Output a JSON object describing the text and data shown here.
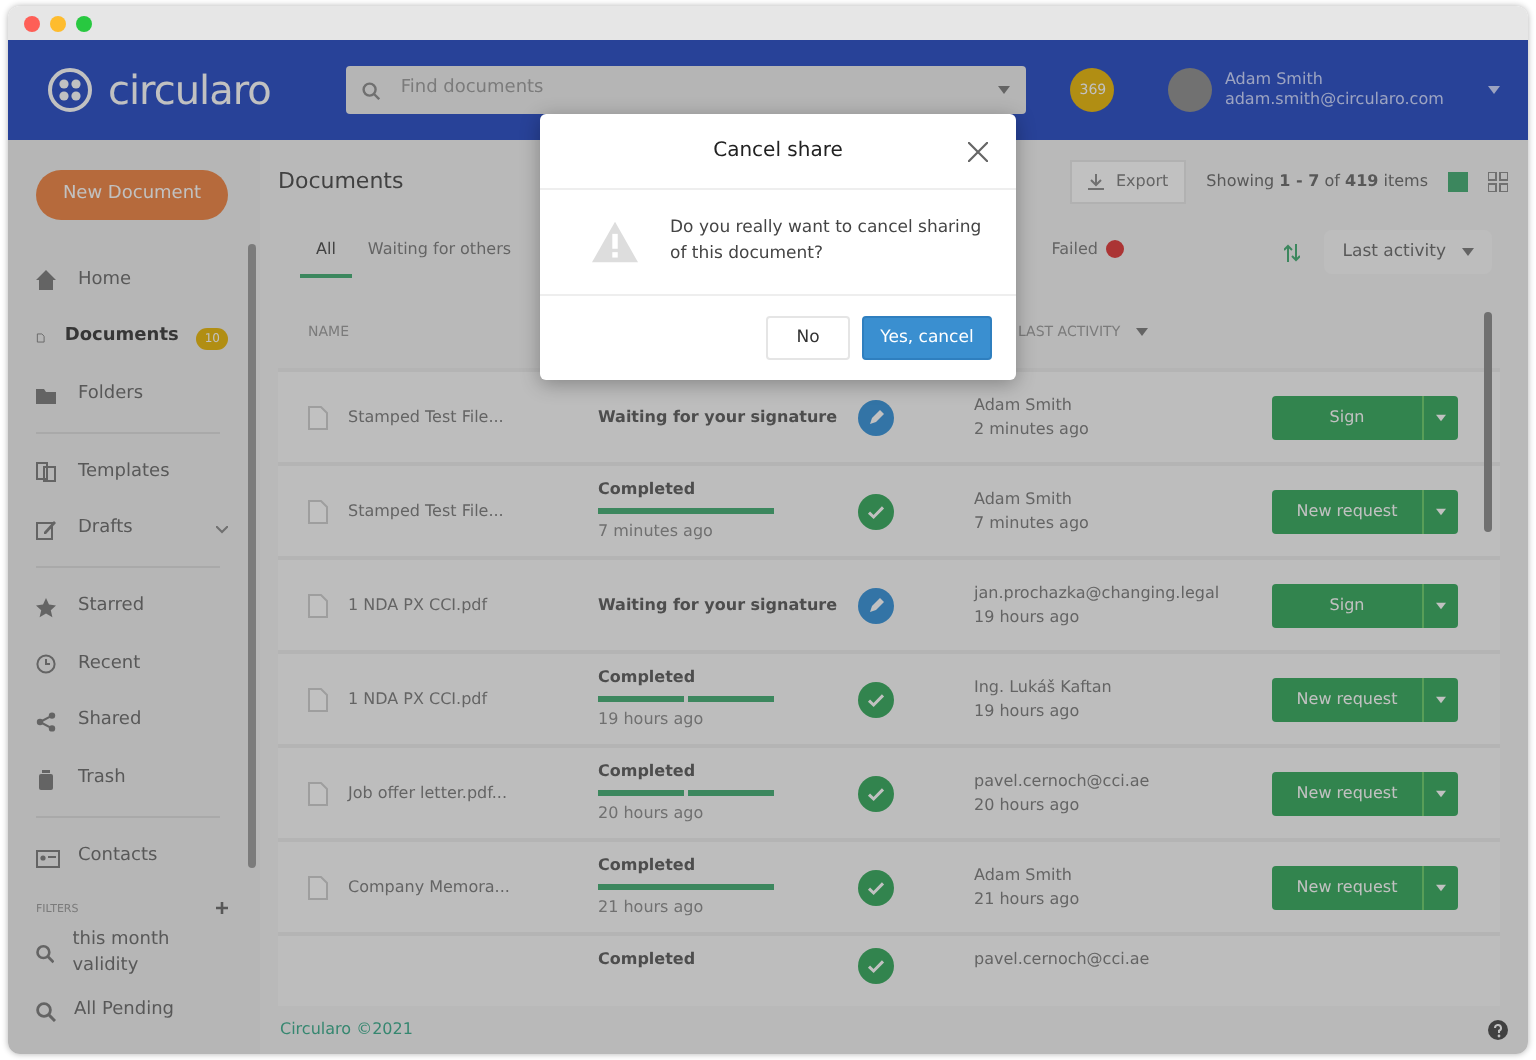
{
  "header": {
    "logo": "circularo",
    "search": {
      "placeholder": "Find documents"
    },
    "credits": "369",
    "user": {
      "name": "Adam Smith",
      "email": "adam.smith@circularo.com"
    }
  },
  "sidebar": {
    "new_button": "New Document",
    "items": [
      {
        "label": "Home",
        "selected": false
      },
      {
        "label": "Documents",
        "selected": true,
        "badge": "10"
      },
      {
        "label": "Folders",
        "selected": false
      },
      {
        "label": "Templates",
        "selected": false
      },
      {
        "label": "Drafts",
        "selected": false,
        "expandable": true
      },
      {
        "label": "Starred",
        "selected": false
      },
      {
        "label": "Recent",
        "selected": false
      },
      {
        "label": "Shared",
        "selected": false
      },
      {
        "label": "Trash",
        "selected": false
      },
      {
        "label": "Contacts",
        "selected": false
      }
    ],
    "filters_label": "FILTERS",
    "filters": [
      "this month validity",
      "All Pending"
    ]
  },
  "main": {
    "title": "Documents",
    "export": "Export",
    "showing": "Showing **1 - 7** of **419** items",
    "views": [
      {
        "kind": "list",
        "selected": true
      },
      {
        "kind": "grid",
        "selected": false
      }
    ],
    "tabs": [
      {
        "label": "All",
        "selected": true
      },
      {
        "label": "Waiting for others",
        "selected": false
      },
      {
        "label": "Failed",
        "selected": false,
        "badge": true
      }
    ],
    "sort": "Last activity",
    "columns": [
      "NAME",
      "LAST ACTIVITY"
    ],
    "rows": [
      {
        "name": "Stamped Test File...",
        "kind": "waiting",
        "status_text": "Waiting for your signature",
        "actor": "Adam Smith",
        "actor_time": "2 minutes ago",
        "action": "Sign"
      },
      {
        "name": "Stamped Test File...",
        "kind": "completed",
        "status_text": "Completed",
        "progress": [
          {
            "level": 1
          }
        ],
        "time": "7 minutes ago",
        "actor": "Adam Smith",
        "actor_time": "7 minutes ago",
        "action": "New request"
      },
      {
        "name": "1 NDA PX CCI.pdf",
        "kind": "waiting",
        "status_text": "Waiting for your signature",
        "actor": "jan.prochazka@changing.legal",
        "actor_time": "19 hours ago",
        "action": "Sign"
      },
      {
        "name": "1 NDA PX CCI.pdf",
        "kind": "completed",
        "status_text": "Completed",
        "progress": [
          {
            "level": 1
          },
          {
            "level": 1
          }
        ],
        "time": "19 hours ago",
        "actor": "Ing. Lukáš Kaftan",
        "actor_time": "19 hours ago",
        "action": "New request"
      },
      {
        "name": "Job offer letter.pdf...",
        "kind": "completed",
        "status_text": "Completed",
        "progress": [
          {
            "level": 1
          },
          {
            "level": 1
          }
        ],
        "time": "20 hours ago",
        "actor": "pavel.cernoch@cci.ae",
        "actor_time": "20 hours ago",
        "action": "New request"
      },
      {
        "name": "Company Memora...",
        "kind": "completed",
        "status_text": "Completed",
        "progress": [
          {
            "level": 1
          }
        ],
        "time": "21 hours ago",
        "actor": "Adam Smith",
        "actor_time": "21 hours ago",
        "action": "New request"
      },
      {
        "kind": "completed",
        "status_text": "Completed",
        "actor": "pavel.cernoch@cci.ae"
      }
    ],
    "footer": "Circularo ©2021"
  },
  "modal": {
    "title": "Cancel share",
    "message": "Do you really want to cancel sharing of this document?",
    "buttons": [
      {
        "label": "No",
        "kind": "secondary"
      },
      {
        "label": "Yes, cancel",
        "kind": "primary"
      }
    ]
  }
}
